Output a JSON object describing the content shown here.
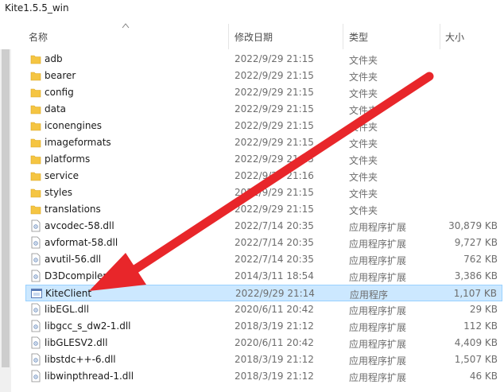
{
  "window": {
    "path": "Kite1.5.5_win"
  },
  "columns": {
    "name": "名称",
    "date": "修改日期",
    "type": "类型",
    "size": "大小"
  },
  "colors": {
    "selected_bg": "#cce8ff",
    "folder": "#f5c542",
    "arrow": "#e8262a"
  },
  "files": [
    {
      "name": "adb",
      "date": "2022/9/29 21:15",
      "type": "文件夹",
      "size": "",
      "icon": "folder-icon"
    },
    {
      "name": "bearer",
      "date": "2022/9/29 21:15",
      "type": "文件夹",
      "size": "",
      "icon": "folder-icon"
    },
    {
      "name": "config",
      "date": "2022/9/29 21:15",
      "type": "文件夹",
      "size": "",
      "icon": "folder-icon"
    },
    {
      "name": "data",
      "date": "2022/9/29 21:15",
      "type": "文件夹",
      "size": "",
      "icon": "folder-icon"
    },
    {
      "name": "iconengines",
      "date": "2022/9/29 21:15",
      "type": "文件夹",
      "size": "",
      "icon": "folder-icon"
    },
    {
      "name": "imageformats",
      "date": "2022/9/29 21:15",
      "type": "文件夹",
      "size": "",
      "icon": "folder-icon"
    },
    {
      "name": "platforms",
      "date": "2022/9/29 21:15",
      "type": "文件夹",
      "size": "",
      "icon": "folder-icon"
    },
    {
      "name": "service",
      "date": "2022/9/29 21:16",
      "type": "文件夹",
      "size": "",
      "icon": "folder-icon"
    },
    {
      "name": "styles",
      "date": "2022/9/29 21:15",
      "type": "文件夹",
      "size": "",
      "icon": "folder-icon"
    },
    {
      "name": "translations",
      "date": "2022/9/29 21:15",
      "type": "文件夹",
      "size": "",
      "icon": "folder-icon"
    },
    {
      "name": "avcodec-58.dll",
      "date": "2022/7/14 20:35",
      "type": "应用程序扩展",
      "size": "30,879 KB",
      "icon": "dll-icon"
    },
    {
      "name": "avformat-58.dll",
      "date": "2022/7/14 20:35",
      "type": "应用程序扩展",
      "size": "9,727 KB",
      "icon": "dll-icon"
    },
    {
      "name": "avutil-56.dll",
      "date": "2022/7/14 20:35",
      "type": "应用程序扩展",
      "size": "762 KB",
      "icon": "dll-icon"
    },
    {
      "name": "D3Dcompiler_47.dll",
      "date": "2014/3/11 18:54",
      "type": "应用程序扩展",
      "size": "3,386 KB",
      "icon": "dll-icon"
    },
    {
      "name": "KiteClient",
      "date": "2022/9/29 21:14",
      "type": "应用程序",
      "size": "1,107 KB",
      "icon": "app-icon",
      "selected": true
    },
    {
      "name": "libEGL.dll",
      "date": "2020/6/11 20:42",
      "type": "应用程序扩展",
      "size": "29 KB",
      "icon": "dll-icon"
    },
    {
      "name": "libgcc_s_dw2-1.dll",
      "date": "2018/3/19 21:12",
      "type": "应用程序扩展",
      "size": "112 KB",
      "icon": "dll-icon"
    },
    {
      "name": "libGLESV2.dll",
      "date": "2020/6/11 20:42",
      "type": "应用程序扩展",
      "size": "4,409 KB",
      "icon": "dll-icon"
    },
    {
      "name": "libstdc++-6.dll",
      "date": "2018/3/19 21:12",
      "type": "应用程序扩展",
      "size": "1,507 KB",
      "icon": "dll-icon"
    },
    {
      "name": "libwinpthread-1.dll",
      "date": "2018/3/19 21:12",
      "type": "应用程序扩展",
      "size": "46 KB",
      "icon": "dll-icon"
    }
  ]
}
